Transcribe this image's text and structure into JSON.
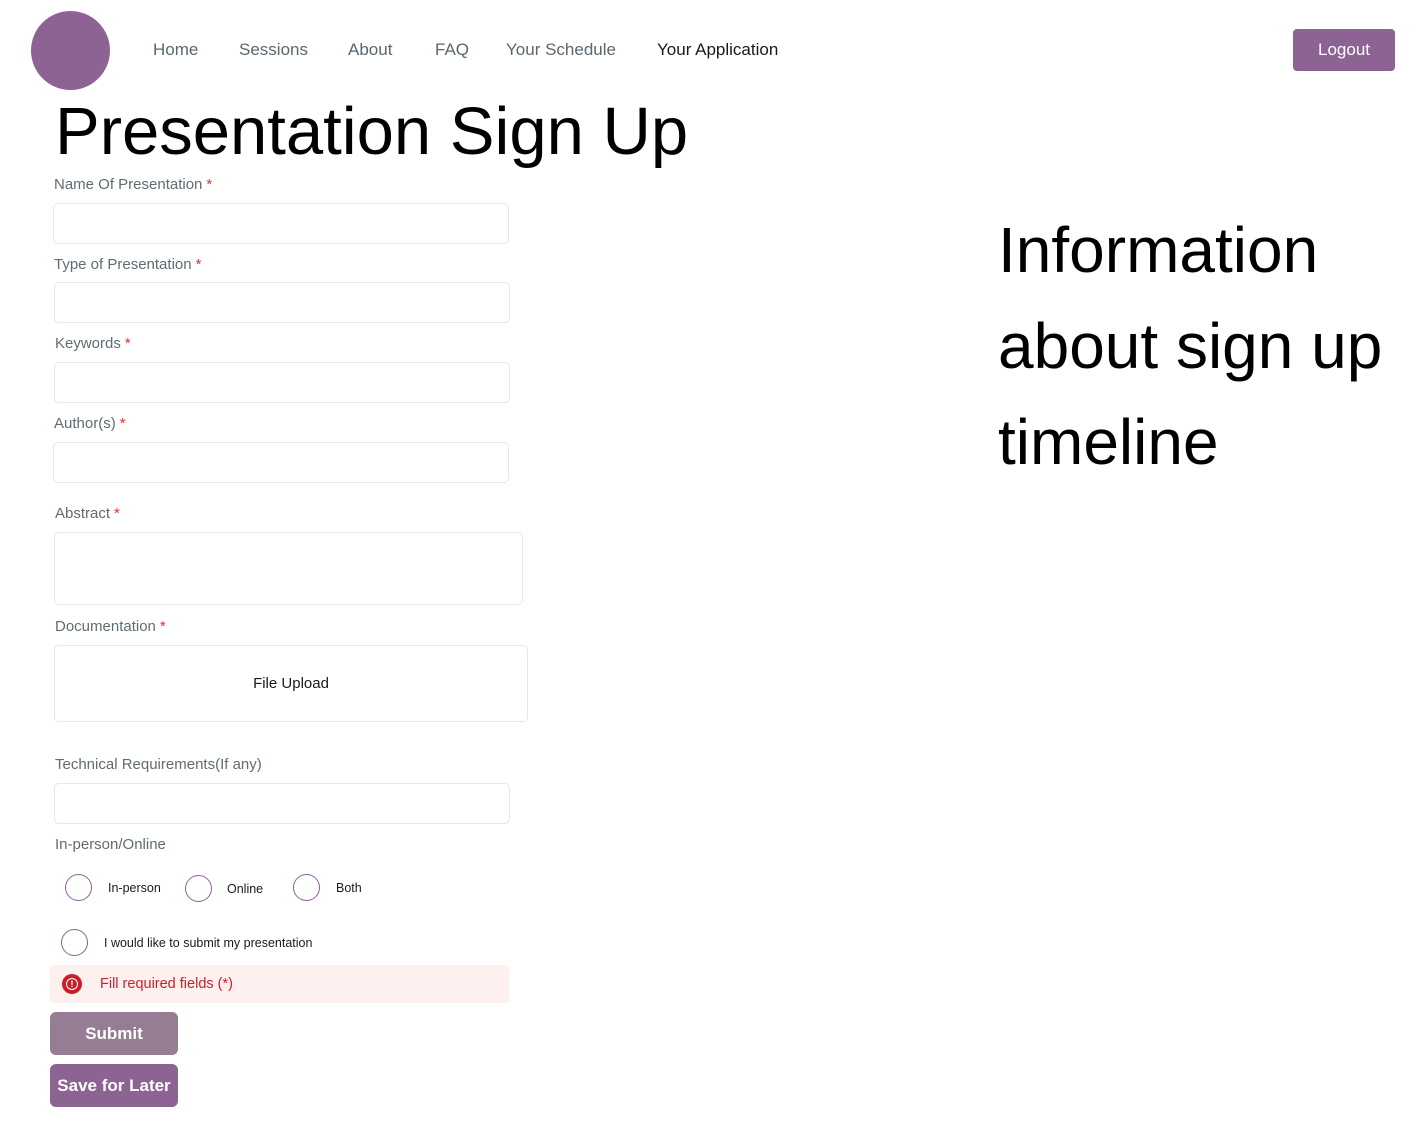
{
  "nav": {
    "items": [
      {
        "label": "Home"
      },
      {
        "label": "Sessions"
      },
      {
        "label": "About"
      },
      {
        "label": "FAQ"
      },
      {
        "label": "Your Schedule"
      },
      {
        "label": "Your Application"
      }
    ],
    "active_item": "Your Application",
    "logout_label": "Logout"
  },
  "page": {
    "title": "Presentation Sign Up"
  },
  "form": {
    "required_marker": "*",
    "name": {
      "label": "Name Of Presentation",
      "value": ""
    },
    "type": {
      "label": "Type of Presentation",
      "value": ""
    },
    "keywords": {
      "label": "Keywords",
      "value": ""
    },
    "authors": {
      "label": "Author(s)",
      "value": ""
    },
    "abstract": {
      "label": "Abstract",
      "value": ""
    },
    "documentation": {
      "label": "Documentation",
      "upload_label": "File Upload"
    },
    "tech": {
      "label": "Technical Requirements(If any)",
      "value": ""
    },
    "mode": {
      "label": "In-person/Online",
      "options": [
        {
          "label": "In-person",
          "selected": false
        },
        {
          "label": "Online",
          "selected": false
        },
        {
          "label": "Both",
          "selected": false
        }
      ]
    },
    "submit_consent": {
      "label": "I would like to submit my presentation",
      "selected": false
    },
    "error": {
      "text": "Fill required fields (*)"
    },
    "submit_label": "Submit",
    "save_label": "Save for Later"
  },
  "info": {
    "heading": "Information about sign up timeline"
  },
  "colors": {
    "brand": "#8d6394",
    "submit_disabled": "#957e93",
    "required": "#e0302c",
    "error_text": "#c91f2b",
    "error_bg": "#fdf0ef"
  },
  "icons": {
    "error": "alert-circle-icon"
  }
}
